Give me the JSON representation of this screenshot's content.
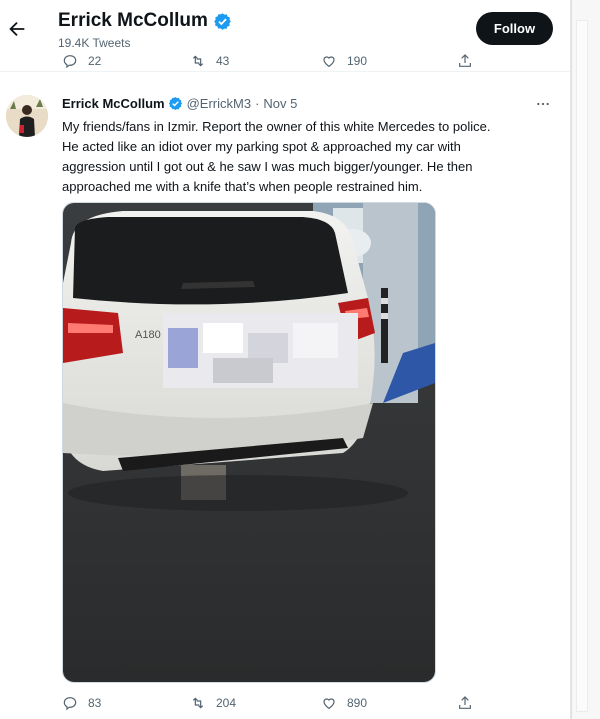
{
  "header": {
    "name": "Errick McCollum",
    "tweet_count": "19.4K Tweets",
    "follow_label": "Follow"
  },
  "previous_tweet": {
    "replies": "22",
    "retweets": "43",
    "likes": "190"
  },
  "tweet": {
    "author_name": "Errick McCollum",
    "handle": "@ErrickM3",
    "separator": "·",
    "date": "Nov 5",
    "text_lines": [
      "My friends/fans in Izmir. Report the owner of this white Mercedes to police.",
      "He acted like an idiot over my parking spot & approached my car with",
      "aggression until I got out & he saw I was much bigger/younger. He then",
      "approached me with a knife that’s when people restrained him."
    ],
    "photo_badge": "A180",
    "replies": "83",
    "retweets": "204",
    "likes": "890"
  },
  "colors": {
    "text": "#0f1419",
    "muted": "#536471",
    "verified": "#1d9bf0",
    "follow_bg": "#0f1419"
  },
  "icons": [
    "back-arrow-icon",
    "verified-badge-icon",
    "reply-icon",
    "retweet-icon",
    "like-icon",
    "share-icon",
    "more-icon"
  ]
}
